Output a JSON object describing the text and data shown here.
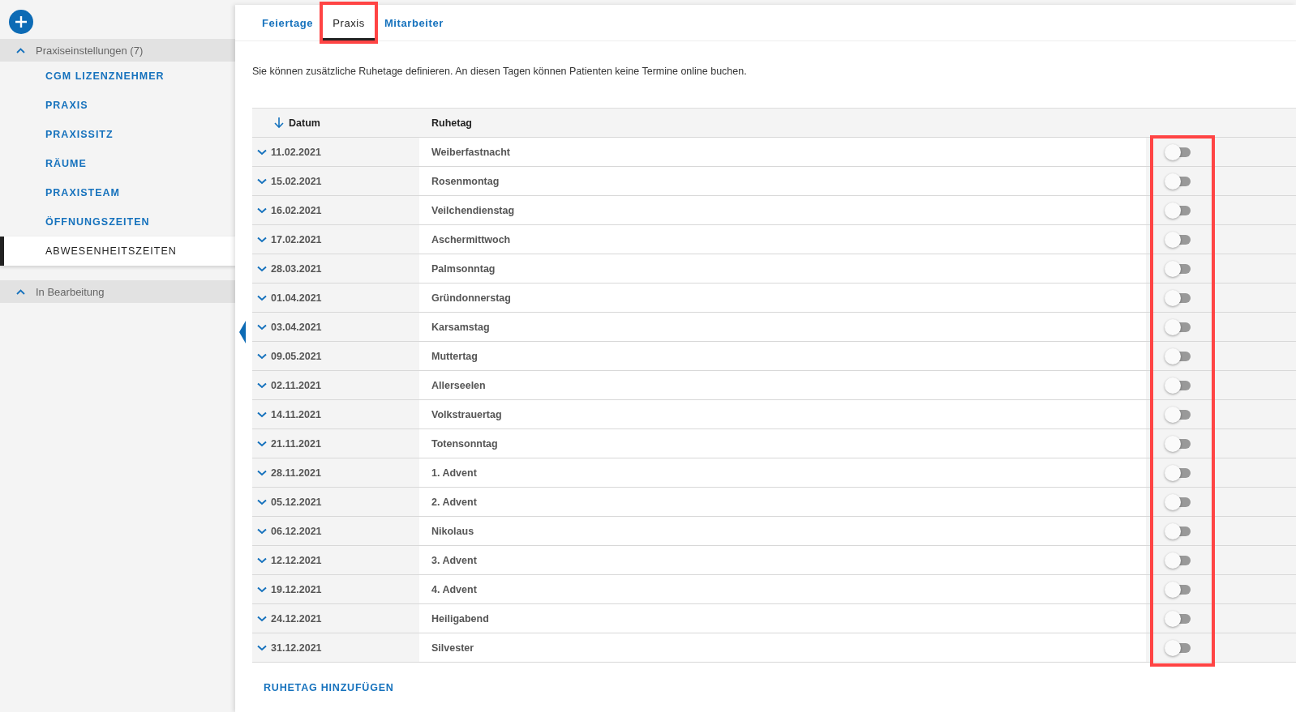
{
  "sidebar": {
    "groups": [
      {
        "label": "Praxiseinstellungen (7)",
        "expanded": true,
        "items": [
          {
            "label": "CGM LIZENZNEHMER",
            "selected": false
          },
          {
            "label": "PRAXIS",
            "selected": false
          },
          {
            "label": "PRAXISSITZ",
            "selected": false
          },
          {
            "label": "RÄUME",
            "selected": false
          },
          {
            "label": "PRAXISTEAM",
            "selected": false
          },
          {
            "label": "ÖFFNUNGSZEITEN",
            "selected": false
          },
          {
            "label": "ABWESENHEITSZEITEN",
            "selected": true
          }
        ]
      },
      {
        "label": "In Bearbeitung",
        "expanded": true
      }
    ]
  },
  "tabs": [
    {
      "label": "Feiertage",
      "selected": false,
      "highlighted": false
    },
    {
      "label": "Praxis",
      "selected": true,
      "highlighted": true
    },
    {
      "label": "Mitarbeiter",
      "selected": false,
      "highlighted": false
    }
  ],
  "description": "Sie können zusätzliche Ruhetage definieren. An diesen Tagen können Patienten keine Termine online buchen.",
  "table": {
    "columns": [
      "Datum",
      "Ruhetag"
    ],
    "toggle_column_highlighted": true,
    "rows": [
      {
        "date": "11.02.2021",
        "name": "Weiberfastnacht",
        "on": false
      },
      {
        "date": "15.02.2021",
        "name": "Rosenmontag",
        "on": false
      },
      {
        "date": "16.02.2021",
        "name": "Veilchendienstag",
        "on": false
      },
      {
        "date": "17.02.2021",
        "name": "Aschermittwoch",
        "on": false
      },
      {
        "date": "28.03.2021",
        "name": "Palmsonntag",
        "on": false
      },
      {
        "date": "01.04.2021",
        "name": "Gründonnerstag",
        "on": false
      },
      {
        "date": "03.04.2021",
        "name": "Karsamstag",
        "on": false
      },
      {
        "date": "09.05.2021",
        "name": "Muttertag",
        "on": false
      },
      {
        "date": "02.11.2021",
        "name": "Allerseelen",
        "on": false
      },
      {
        "date": "14.11.2021",
        "name": "Volkstrauertag",
        "on": false
      },
      {
        "date": "21.11.2021",
        "name": "Totensonntag",
        "on": false
      },
      {
        "date": "28.11.2021",
        "name": "1. Advent",
        "on": false
      },
      {
        "date": "05.12.2021",
        "name": "2. Advent",
        "on": false
      },
      {
        "date": "06.12.2021",
        "name": "Nikolaus",
        "on": false
      },
      {
        "date": "12.12.2021",
        "name": "3. Advent",
        "on": false
      },
      {
        "date": "19.12.2021",
        "name": "4. Advent",
        "on": false
      },
      {
        "date": "24.12.2021",
        "name": "Heiligabend",
        "on": false
      },
      {
        "date": "31.12.2021",
        "name": "Silvester",
        "on": false
      }
    ]
  },
  "add_button": "RUHETAG HINZUFÜGEN"
}
